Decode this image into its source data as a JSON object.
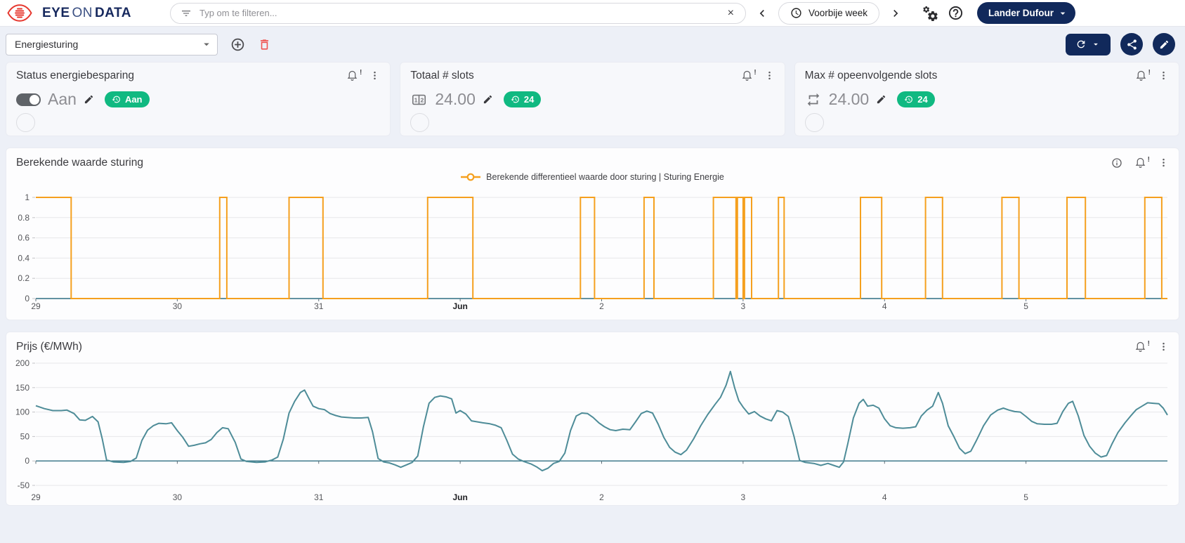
{
  "header": {
    "brand": {
      "eye": "EYE",
      "on": "ON",
      "data": "DATA"
    },
    "search": {
      "placeholder": "Typ om te filteren...",
      "clear_label": "×"
    },
    "time_range": {
      "label": "Voorbije week"
    },
    "user": {
      "name": "Lander Dufour"
    },
    "icons": [
      "filter-variant",
      "clock",
      "chevron-left",
      "chevron-right",
      "gears-settings",
      "help-circle"
    ]
  },
  "toolbar": {
    "dashboard_select": {
      "value": "Energiesturing"
    },
    "icons": [
      "plus-circle",
      "trash",
      "refresh",
      "share",
      "pencil"
    ]
  },
  "cards": [
    {
      "title": "Status energiebesparing",
      "control": "toggle-on",
      "value_label": "Aan",
      "badge": "Aan",
      "badge_icon": "history",
      "alert_mark": "!"
    },
    {
      "title": "Totaal # slots",
      "value": "24.00",
      "badge": "24",
      "value_icon": "numeric-slots",
      "badge_icon": "history",
      "alert_mark": "!"
    },
    {
      "title": "Max # opeenvolgende slots",
      "value": "24.00",
      "badge": "24",
      "value_icon": "repeat",
      "badge_icon": "history",
      "alert_mark": "!"
    }
  ],
  "chart_data": [
    {
      "type": "line",
      "variant": "step-pulse",
      "title": "Berekende waarde sturing",
      "legend": "Berekende differentieel waarde door sturing | Sturing Energie",
      "legend_position": "top-center",
      "color": "#F5A01E",
      "axis_color": "#2F6F82",
      "grid": true,
      "xlim": [
        0,
        8
      ],
      "ylim": [
        0,
        1
      ],
      "x_unit": "days (0 = May 29)",
      "value_high": 1,
      "value_low": 0,
      "axis_y": 0,
      "yticks": [
        {
          "v": 0,
          "label": "0"
        },
        {
          "v": 0.2,
          "label": "0.2"
        },
        {
          "v": 0.4,
          "label": "0.4"
        },
        {
          "v": 0.6,
          "label": "0.6"
        },
        {
          "v": 0.8,
          "label": "0.8"
        },
        {
          "v": 1,
          "label": "1"
        }
      ],
      "xticks": [
        {
          "x": 0,
          "label": "29"
        },
        {
          "x": 1,
          "label": "30"
        },
        {
          "x": 2,
          "label": "31"
        },
        {
          "x": 3,
          "label": "Jun",
          "bold": true
        },
        {
          "x": 4,
          "label": "2"
        },
        {
          "x": 5,
          "label": "3"
        },
        {
          "x": 6,
          "label": "4"
        },
        {
          "x": 7,
          "label": "5"
        }
      ],
      "pulses": [
        [
          0,
          0.25
        ],
        [
          1.3,
          1.35
        ],
        [
          1.79,
          2.03
        ],
        [
          2.77,
          3.09
        ],
        [
          3.85,
          3.95
        ],
        [
          4.3,
          4.37
        ],
        [
          4.79,
          4.95
        ],
        [
          4.96,
          5.0
        ],
        [
          5.01,
          5.06
        ],
        [
          5.25,
          5.29
        ],
        [
          5.83,
          5.98
        ],
        [
          6.29,
          6.41
        ],
        [
          6.83,
          6.95
        ],
        [
          7.29,
          7.42
        ],
        [
          7.84,
          7.96
        ]
      ]
    },
    {
      "type": "line",
      "title": "Prijs (€/MWh)",
      "color": "#4E8C98",
      "axis_color": "#2F6F82",
      "grid": true,
      "legend_position": "none",
      "xlim": [
        0,
        8
      ],
      "ylim": [
        -50,
        200
      ],
      "x_unit": "days (0 = May 29)",
      "axis_y": 0,
      "yticks": [
        {
          "v": -50,
          "label": "-50"
        },
        {
          "v": 0,
          "label": "0"
        },
        {
          "v": 50,
          "label": "50"
        },
        {
          "v": 100,
          "label": "100"
        },
        {
          "v": 150,
          "label": "150"
        },
        {
          "v": 200,
          "label": "200"
        }
      ],
      "xticks": [
        {
          "x": 0,
          "label": "29"
        },
        {
          "x": 1,
          "label": "30"
        },
        {
          "x": 2,
          "label": "31"
        },
        {
          "x": 3,
          "label": "Jun",
          "bold": true
        },
        {
          "x": 4,
          "label": "2"
        },
        {
          "x": 5,
          "label": "3"
        },
        {
          "x": 6,
          "label": "4"
        },
        {
          "x": 7,
          "label": "5"
        }
      ],
      "points": [
        [
          0.0,
          113
        ],
        [
          0.06,
          107
        ],
        [
          0.12,
          103
        ],
        [
          0.18,
          103
        ],
        [
          0.22,
          104
        ],
        [
          0.27,
          97
        ],
        [
          0.31,
          84
        ],
        [
          0.35,
          83
        ],
        [
          0.4,
          91
        ],
        [
          0.44,
          80
        ],
        [
          0.47,
          45
        ],
        [
          0.5,
          2
        ],
        [
          0.55,
          -2
        ],
        [
          0.62,
          -3
        ],
        [
          0.67,
          -1
        ],
        [
          0.71,
          6
        ],
        [
          0.75,
          42
        ],
        [
          0.79,
          63
        ],
        [
          0.83,
          72
        ],
        [
          0.87,
          77
        ],
        [
          0.92,
          76
        ],
        [
          0.96,
          78
        ],
        [
          1.0,
          62
        ],
        [
          1.04,
          48
        ],
        [
          1.08,
          30
        ],
        [
          1.12,
          32
        ],
        [
          1.16,
          35
        ],
        [
          1.2,
          37
        ],
        [
          1.24,
          44
        ],
        [
          1.28,
          58
        ],
        [
          1.32,
          68
        ],
        [
          1.36,
          66
        ],
        [
          1.41,
          38
        ],
        [
          1.45,
          4
        ],
        [
          1.49,
          -1
        ],
        [
          1.56,
          -3
        ],
        [
          1.62,
          -2
        ],
        [
          1.67,
          2
        ],
        [
          1.71,
          8
        ],
        [
          1.75,
          45
        ],
        [
          1.79,
          98
        ],
        [
          1.83,
          122
        ],
        [
          1.87,
          140
        ],
        [
          1.9,
          145
        ],
        [
          1.93,
          128
        ],
        [
          1.96,
          112
        ],
        [
          2.0,
          107
        ],
        [
          2.04,
          105
        ],
        [
          2.08,
          97
        ],
        [
          2.12,
          93
        ],
        [
          2.16,
          90
        ],
        [
          2.2,
          89
        ],
        [
          2.25,
          88
        ],
        [
          2.3,
          88
        ],
        [
          2.35,
          89
        ],
        [
          2.38,
          60
        ],
        [
          2.42,
          5
        ],
        [
          2.46,
          -2
        ],
        [
          2.5,
          -4
        ],
        [
          2.54,
          -8
        ],
        [
          2.58,
          -13
        ],
        [
          2.62,
          -8
        ],
        [
          2.66,
          -3
        ],
        [
          2.7,
          10
        ],
        [
          2.74,
          70
        ],
        [
          2.78,
          118
        ],
        [
          2.82,
          130
        ],
        [
          2.86,
          133
        ],
        [
          2.9,
          131
        ],
        [
          2.94,
          127
        ],
        [
          2.97,
          98
        ],
        [
          3.0,
          103
        ],
        [
          3.04,
          96
        ],
        [
          3.08,
          82
        ],
        [
          3.12,
          80
        ],
        [
          3.16,
          78
        ],
        [
          3.21,
          76
        ],
        [
          3.25,
          73
        ],
        [
          3.29,
          68
        ],
        [
          3.33,
          42
        ],
        [
          3.37,
          14
        ],
        [
          3.41,
          4
        ],
        [
          3.45,
          -1
        ],
        [
          3.5,
          -6
        ],
        [
          3.54,
          -12
        ],
        [
          3.58,
          -20
        ],
        [
          3.62,
          -15
        ],
        [
          3.66,
          -5
        ],
        [
          3.7,
          -1
        ],
        [
          3.74,
          16
        ],
        [
          3.78,
          62
        ],
        [
          3.82,
          92
        ],
        [
          3.86,
          98
        ],
        [
          3.9,
          97
        ],
        [
          3.94,
          89
        ],
        [
          3.98,
          78
        ],
        [
          4.02,
          70
        ],
        [
          4.06,
          64
        ],
        [
          4.1,
          62
        ],
        [
          4.15,
          65
        ],
        [
          4.2,
          64
        ],
        [
          4.24,
          80
        ],
        [
          4.28,
          97
        ],
        [
          4.32,
          102
        ],
        [
          4.36,
          98
        ],
        [
          4.4,
          75
        ],
        [
          4.44,
          48
        ],
        [
          4.48,
          28
        ],
        [
          4.52,
          18
        ],
        [
          4.56,
          13
        ],
        [
          4.6,
          22
        ],
        [
          4.65,
          45
        ],
        [
          4.7,
          72
        ],
        [
          4.75,
          95
        ],
        [
          4.8,
          115
        ],
        [
          4.84,
          130
        ],
        [
          4.88,
          155
        ],
        [
          4.91,
          183
        ],
        [
          4.94,
          150
        ],
        [
          4.97,
          123
        ],
        [
          5.0,
          110
        ],
        [
          5.04,
          96
        ],
        [
          5.08,
          101
        ],
        [
          5.12,
          92
        ],
        [
          5.16,
          86
        ],
        [
          5.2,
          82
        ],
        [
          5.24,
          103
        ],
        [
          5.28,
          100
        ],
        [
          5.32,
          91
        ],
        [
          5.36,
          50
        ],
        [
          5.4,
          1
        ],
        [
          5.44,
          -3
        ],
        [
          5.5,
          -5
        ],
        [
          5.55,
          -9
        ],
        [
          5.6,
          -5
        ],
        [
          5.64,
          -9
        ],
        [
          5.68,
          -13
        ],
        [
          5.71,
          -2
        ],
        [
          5.74,
          35
        ],
        [
          5.78,
          88
        ],
        [
          5.82,
          118
        ],
        [
          5.85,
          126
        ],
        [
          5.88,
          112
        ],
        [
          5.92,
          114
        ],
        [
          5.96,
          108
        ],
        [
          6.0,
          86
        ],
        [
          6.04,
          72
        ],
        [
          6.08,
          68
        ],
        [
          6.13,
          67
        ],
        [
          6.18,
          68
        ],
        [
          6.22,
          70
        ],
        [
          6.26,
          92
        ],
        [
          6.3,
          104
        ],
        [
          6.34,
          112
        ],
        [
          6.38,
          140
        ],
        [
          6.41,
          118
        ],
        [
          6.45,
          72
        ],
        [
          6.49,
          50
        ],
        [
          6.53,
          26
        ],
        [
          6.57,
          15
        ],
        [
          6.61,
          20
        ],
        [
          6.65,
          42
        ],
        [
          6.7,
          72
        ],
        [
          6.75,
          94
        ],
        [
          6.8,
          104
        ],
        [
          6.84,
          108
        ],
        [
          6.88,
          104
        ],
        [
          6.92,
          101
        ],
        [
          6.96,
          100
        ],
        [
          7.0,
          91
        ],
        [
          7.04,
          81
        ],
        [
          7.08,
          76
        ],
        [
          7.13,
          75
        ],
        [
          7.18,
          75
        ],
        [
          7.22,
          77
        ],
        [
          7.26,
          101
        ],
        [
          7.3,
          118
        ],
        [
          7.33,
          122
        ],
        [
          7.37,
          92
        ],
        [
          7.41,
          52
        ],
        [
          7.45,
          30
        ],
        [
          7.49,
          16
        ],
        [
          7.53,
          8
        ],
        [
          7.57,
          11
        ],
        [
          7.61,
          36
        ],
        [
          7.65,
          58
        ],
        [
          7.7,
          78
        ],
        [
          7.74,
          92
        ],
        [
          7.78,
          105
        ],
        [
          7.82,
          112
        ],
        [
          7.86,
          119
        ],
        [
          7.9,
          118
        ],
        [
          7.94,
          117
        ],
        [
          7.97,
          108
        ],
        [
          8.0,
          94
        ]
      ]
    }
  ]
}
